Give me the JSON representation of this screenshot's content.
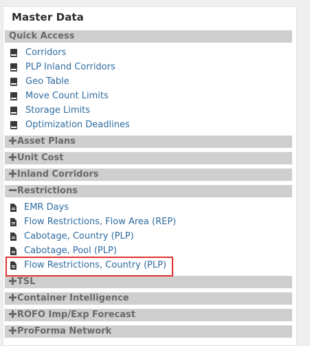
{
  "panel": {
    "title": "Master Data"
  },
  "quick_access": {
    "label": "Quick Access",
    "items": [
      {
        "label": "Corridors",
        "icon": "book-icon"
      },
      {
        "label": "PLP Inland Corridors",
        "icon": "book-icon"
      },
      {
        "label": "Geo Table",
        "icon": "book-icon"
      },
      {
        "label": "Move Count Limits",
        "icon": "book-icon"
      },
      {
        "label": "Storage Limits",
        "icon": "book-icon"
      },
      {
        "label": "Optimization Deadlines",
        "icon": "book-icon"
      }
    ]
  },
  "sections": {
    "asset_plans": {
      "label": "Asset Plans",
      "state": "collapsed"
    },
    "unit_cost": {
      "label": "Unit Cost",
      "state": "collapsed"
    },
    "inland_corridors": {
      "label": "Inland Corridors",
      "state": "collapsed"
    },
    "restrictions": {
      "label": "Restrictions",
      "state": "expanded",
      "items": [
        {
          "label": "EMR Days",
          "icon": "document-icon"
        },
        {
          "label": "Flow Restrictions, Flow Area (REP)",
          "icon": "document-icon"
        },
        {
          "label": "Cabotage, Country (PLP)",
          "icon": "document-icon"
        },
        {
          "label": "Cabotage, Pool (PLP)",
          "icon": "document-icon"
        },
        {
          "label": "Flow Restrictions, Country (PLP)",
          "icon": "document-icon",
          "highlighted": true
        }
      ]
    },
    "tsl": {
      "label": "TSL",
      "state": "collapsed"
    },
    "container_intelligence": {
      "label": "Container Intelligence",
      "state": "collapsed"
    },
    "rofo": {
      "label": "ROFO Imp/Exp Forecast",
      "state": "collapsed"
    },
    "proforma_network": {
      "label": "ProForma Network",
      "state": "collapsed"
    }
  },
  "colors": {
    "link": "#2f6ca0",
    "header_bg": "#cfcfcf",
    "header_text": "#686868",
    "highlight": "#e03030"
  }
}
